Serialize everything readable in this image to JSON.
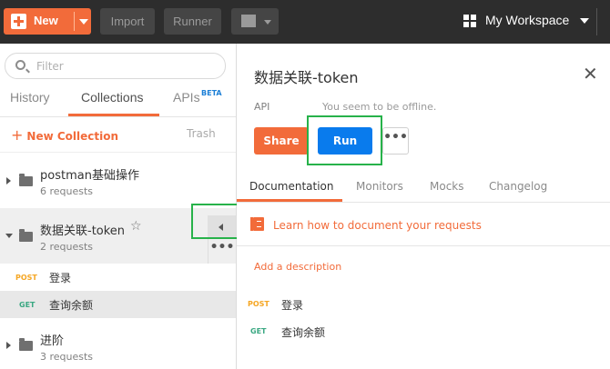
{
  "topbar": {
    "new_label": "New",
    "import_label": "Import",
    "runner_label": "Runner",
    "workspace_label": "My Workspace"
  },
  "sidebar": {
    "search_placeholder": "Filter",
    "tabs": [
      {
        "label": "History",
        "active": false
      },
      {
        "label": "Collections",
        "active": true
      },
      {
        "label": "APIs",
        "active": false
      }
    ],
    "beta_badge": "BETA",
    "new_collection_plus": "+",
    "new_collection_label": "New Collection",
    "trash_label": "Trash",
    "collections": [
      {
        "name": "postman基础操作",
        "count": "6 requests",
        "expanded": false
      },
      {
        "name": "数据关联-token",
        "count": "2 requests",
        "expanded": true
      },
      {
        "name": "进阶",
        "count": "3 requests",
        "expanded": false
      }
    ],
    "requests": [
      {
        "method": "POST",
        "name": "登录",
        "selected": false
      },
      {
        "method": "GET",
        "name": "查询余额",
        "selected": true
      }
    ],
    "more_label": "•••"
  },
  "panel": {
    "title": "数据关联-token",
    "close_label": "✕",
    "api_label": "API",
    "offline_text": "You seem to be offline.",
    "share_label": "Share",
    "run_label": "Run",
    "more_label": "•••",
    "tabs": [
      {
        "label": "Documentation",
        "active": true
      },
      {
        "label": "Monitors",
        "active": false
      },
      {
        "label": "Mocks",
        "active": false
      },
      {
        "label": "Changelog",
        "active": false
      }
    ],
    "doc_link": "Learn how to document your requests",
    "add_description": "Add a description",
    "requests": [
      {
        "method": "POST",
        "name": "登录"
      },
      {
        "method": "GET",
        "name": "查询余额"
      }
    ]
  },
  "colors": {
    "brand_orange": "#f26b3a",
    "run_blue": "#097bed",
    "highlight_green": "#27b24a",
    "topbar_bg": "#2d2d2d"
  }
}
